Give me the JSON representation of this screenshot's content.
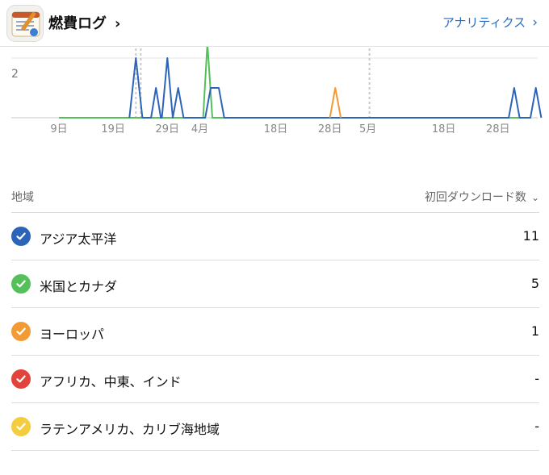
{
  "header": {
    "app_title": "燃費ログ",
    "app_title_chevron": "›",
    "analytics_label": "アナリティクス",
    "analytics_chevron": "›"
  },
  "chart_data": {
    "type": "line",
    "ylabel": "",
    "ytick_labels": [
      "2"
    ],
    "ylim": [
      0,
      2.2
    ],
    "x_tick_labels": [
      "9日",
      "19日",
      "29日",
      "4月",
      "18日",
      "28日",
      "5月",
      "18日",
      "28日"
    ],
    "x_tick_days": [
      9,
      19,
      29,
      35,
      49,
      59,
      66,
      80,
      90
    ],
    "x_range_days": [
      9,
      96
    ],
    "vertical_markers_days": [
      23.2,
      24.1,
      66.3
    ],
    "series": [
      {
        "color": "#2c64b8",
        "points": [
          [
            22,
            0
          ],
          [
            23.2,
            2
          ],
          [
            24.4,
            0
          ],
          [
            26,
            0
          ],
          [
            26.9,
            1
          ],
          [
            27.8,
            0
          ],
          [
            28,
            0
          ],
          [
            29,
            2
          ],
          [
            30,
            0
          ],
          [
            31,
            1
          ],
          [
            32,
            0
          ],
          [
            36,
            0
          ],
          [
            37,
            1
          ],
          [
            38.5,
            1
          ],
          [
            39.5,
            0
          ],
          [
            92,
            0
          ],
          [
            93,
            1
          ],
          [
            94,
            0
          ],
          [
            96,
            0
          ],
          [
            97,
            1
          ],
          [
            98,
            0
          ]
        ]
      },
      {
        "color": "#54c05a",
        "points": [
          [
            9,
            0
          ],
          [
            35.6,
            0
          ],
          [
            36.4,
            2.5
          ],
          [
            37.3,
            0
          ],
          [
            96,
            0
          ]
        ]
      },
      {
        "color": "#f29a33",
        "points": [
          [
            59,
            0
          ],
          [
            60,
            1
          ],
          [
            61,
            0
          ]
        ]
      }
    ]
  },
  "table": {
    "col_region": "地域",
    "col_metric": "初回ダウンロード数",
    "col_metric_chevron": "⌄",
    "rows": [
      {
        "label": "アジア太平洋",
        "value": "11",
        "color": "#2c64b8"
      },
      {
        "label": "米国とカナダ",
        "value": "5",
        "color": "#54c05a"
      },
      {
        "label": "ヨーロッパ",
        "value": "1",
        "color": "#f29a33"
      },
      {
        "label": "アフリカ、中東、インド",
        "value": "-",
        "color": "#e2433a"
      },
      {
        "label": "ラテンアメリカ、カリブ海地域",
        "value": "-",
        "color": "#f4cd3f"
      }
    ]
  }
}
